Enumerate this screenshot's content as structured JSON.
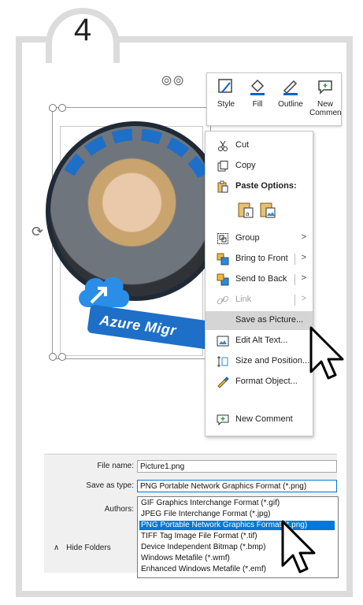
{
  "step": {
    "number": "4"
  },
  "toolbar": {
    "buttons": [
      {
        "label": "Style",
        "icon": "style-icon"
      },
      {
        "label": "Fill",
        "icon": "fill-bucket-icon"
      },
      {
        "label": "Outline",
        "icon": "outline-pen-icon"
      },
      {
        "label": "New Comment",
        "icon": "new-comment-icon"
      }
    ]
  },
  "picture": {
    "banner_text": "Azure Migr"
  },
  "context_menu": {
    "items": [
      {
        "label": "Cut",
        "icon": "scissors-icon"
      },
      {
        "label": "Copy",
        "icon": "copy-icon"
      },
      {
        "label": "Paste Options:",
        "icon": "paste-icon"
      },
      {
        "label": "Group",
        "icon": "group-icon"
      },
      {
        "label": "Bring to Front",
        "icon": "bring-front-icon"
      },
      {
        "label": "Send to Back",
        "icon": "send-back-icon"
      },
      {
        "label": "Link",
        "icon": "link-icon"
      },
      {
        "label": "Save as Picture...",
        "icon": "save-picture-icon"
      },
      {
        "label": "Edit Alt Text...",
        "icon": "alt-text-icon"
      },
      {
        "label": "Size and Position...",
        "icon": "size-position-icon"
      },
      {
        "label": "Format Object...",
        "icon": "format-object-icon"
      },
      {
        "label": "New Comment",
        "icon": "new-comment-icon"
      }
    ],
    "highlight_color": "#d5d5d5"
  },
  "save_dialog": {
    "file_name_label": "File name:",
    "file_name_value": "Picture1.png",
    "save_type_label": "Save as type:",
    "save_type_value": "PNG Portable Network Graphics Format (*.png)",
    "authors_label": "Authors:",
    "hide_folders": "Hide Folders",
    "options": [
      "GIF Graphics Interchange Format (*.gif)",
      "JPEG File Interchange Format (*.jpg)",
      "PNG Portable Network Graphics Format (*.png)",
      "TIFF Tag Image File Format (*.tif)",
      "Device Independent Bitmap (*.bmp)",
      "Windows Metafile (*.wmf)",
      "Enhanced Windows Metafile (*.emf)"
    ],
    "selected_index": 2,
    "accent_color": "#0078d7"
  }
}
